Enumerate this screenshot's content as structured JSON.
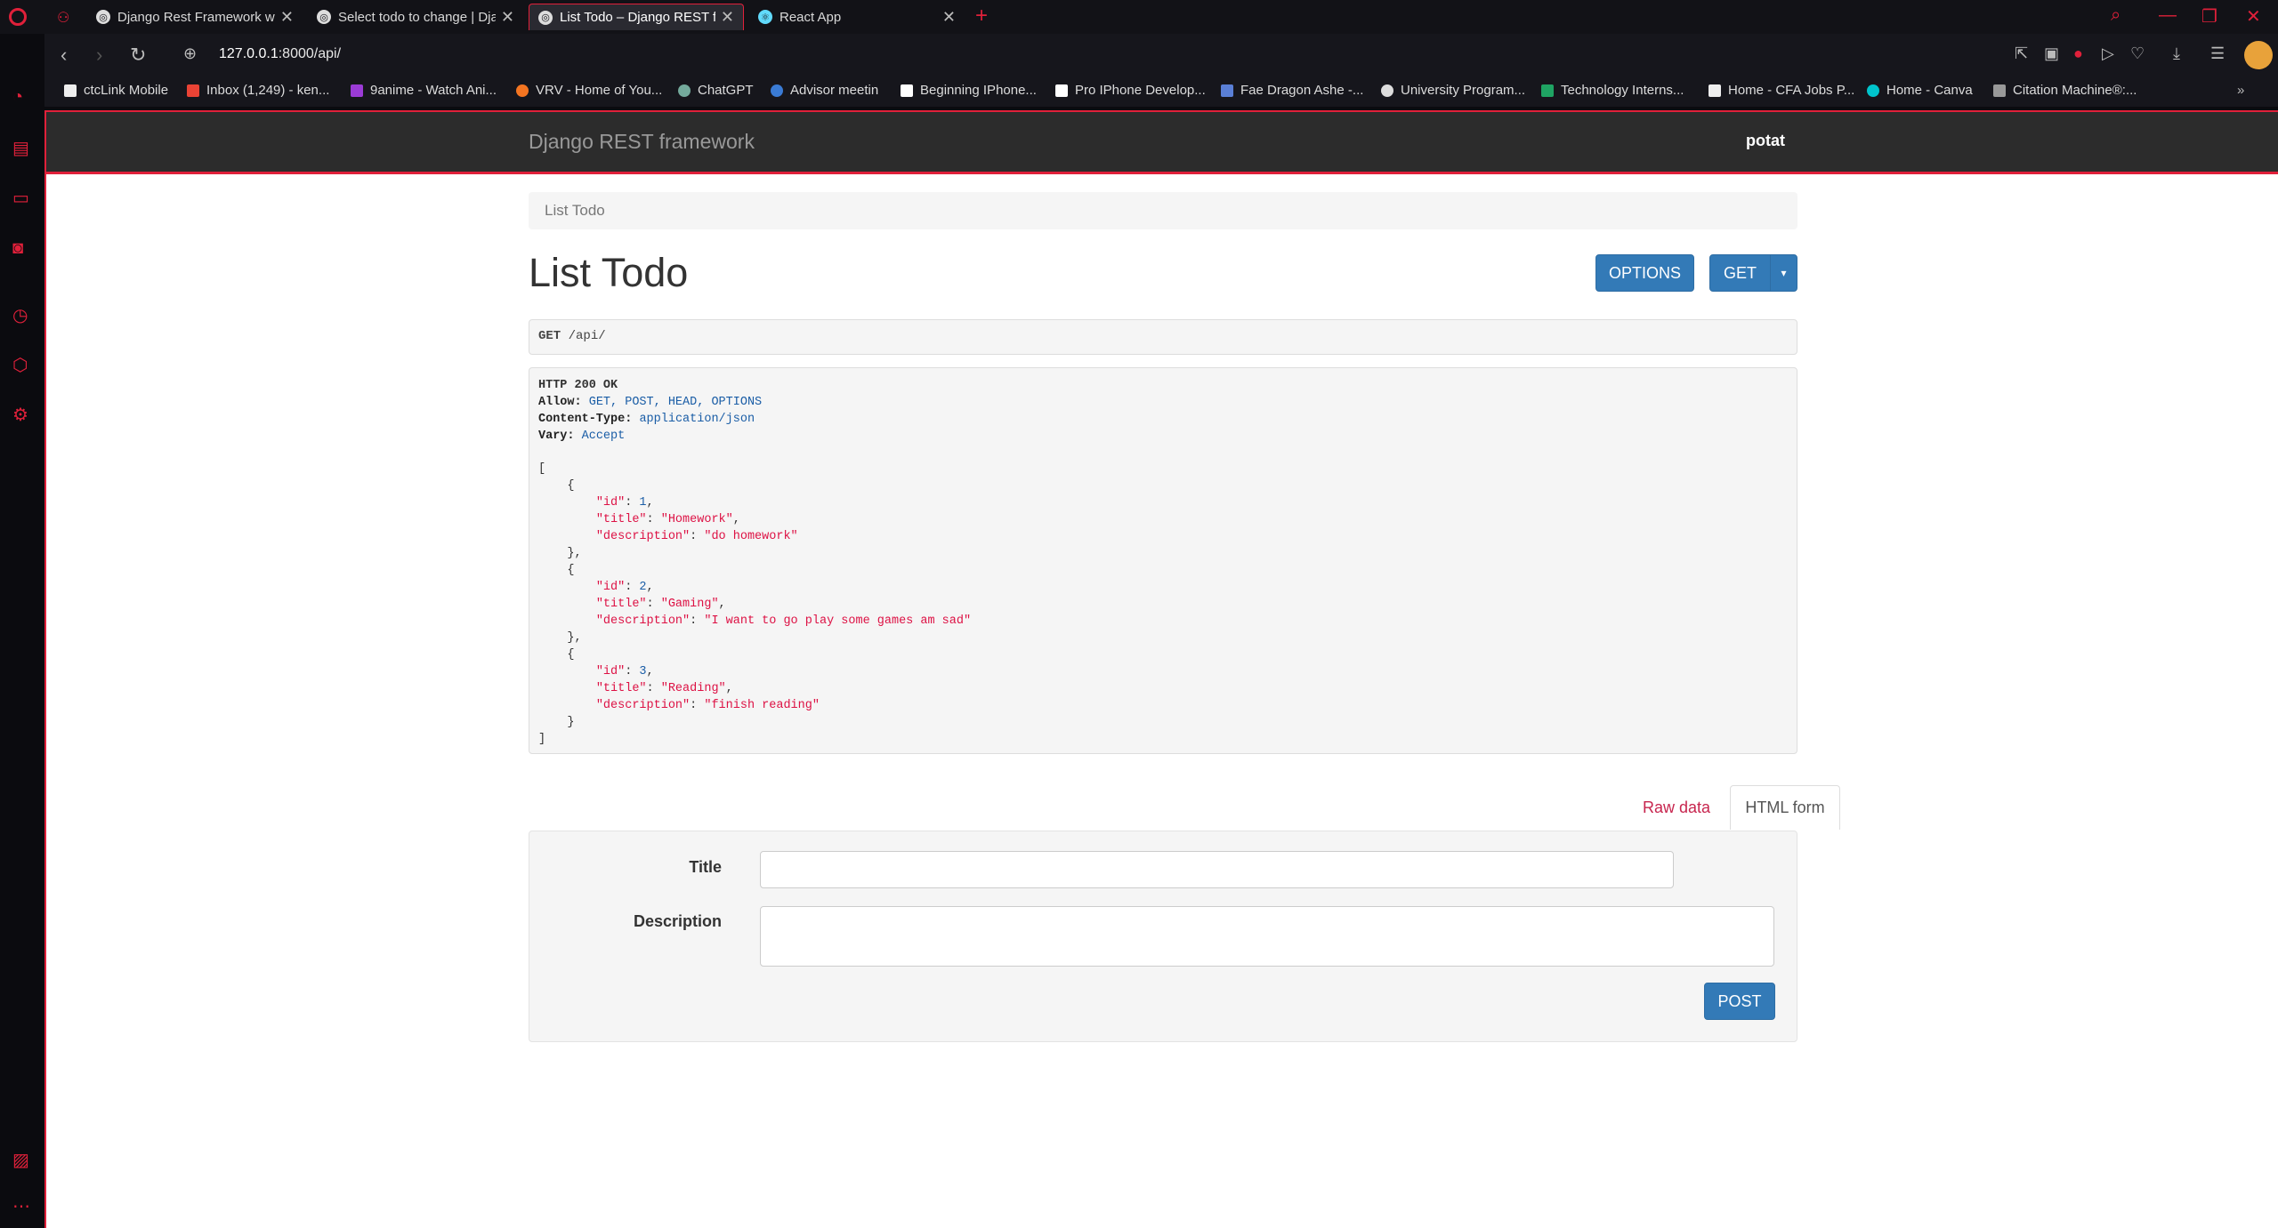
{
  "browser": {
    "tabs": [
      {
        "label": "Django Rest Framework wi",
        "active": false
      },
      {
        "label": "Select todo to change | Dja",
        "active": false
      },
      {
        "label": "List Todo – Django REST fra",
        "active": true
      },
      {
        "label": "React App",
        "active": false
      }
    ],
    "url_host": "127.0.0.1",
    "url_rest": ":8000/api/",
    "bookmarks": [
      "ctcLink Mobile",
      "Inbox (1,249) - ken...",
      "9anime - Watch Ani...",
      "VRV - Home of You...",
      "ChatGPT",
      "Advisor meetin",
      "Beginning IPhone...",
      "Pro IPhone Develop...",
      "Fae Dragon Ashe -...",
      "University Program...",
      "Technology Interns...",
      "Home - CFA Jobs P...",
      "Home - Canva",
      "Citation Machine®:..."
    ],
    "accent": "#e0203a"
  },
  "drf": {
    "brand": "Django REST framework",
    "user": "potat",
    "breadcrumb": "List Todo",
    "title": "List Todo",
    "options_label": "OPTIONS",
    "get_label": "GET",
    "request": {
      "method": "GET",
      "path": "/api/"
    },
    "response": {
      "status": "HTTP 200 OK",
      "allow_key": "Allow:",
      "allow": "GET, POST, HEAD, OPTIONS",
      "ctype_key": "Content-Type:",
      "ctype": "application/json",
      "vary_key": "Vary:",
      "vary": "Accept",
      "items": [
        {
          "id": "1",
          "title": "\"Homework\"",
          "description": "\"do homework\""
        },
        {
          "id": "2",
          "title": "\"Gaming\"",
          "description": "\"I want to go play some games am sad\""
        },
        {
          "id": "3",
          "title": "\"Reading\"",
          "description": "\"finish reading\""
        }
      ]
    },
    "tab_raw": "Raw data",
    "tab_html": "HTML form",
    "form": {
      "title_label": "Title",
      "description_label": "Description",
      "post_label": "POST"
    },
    "primary_color": "#337ab7"
  }
}
